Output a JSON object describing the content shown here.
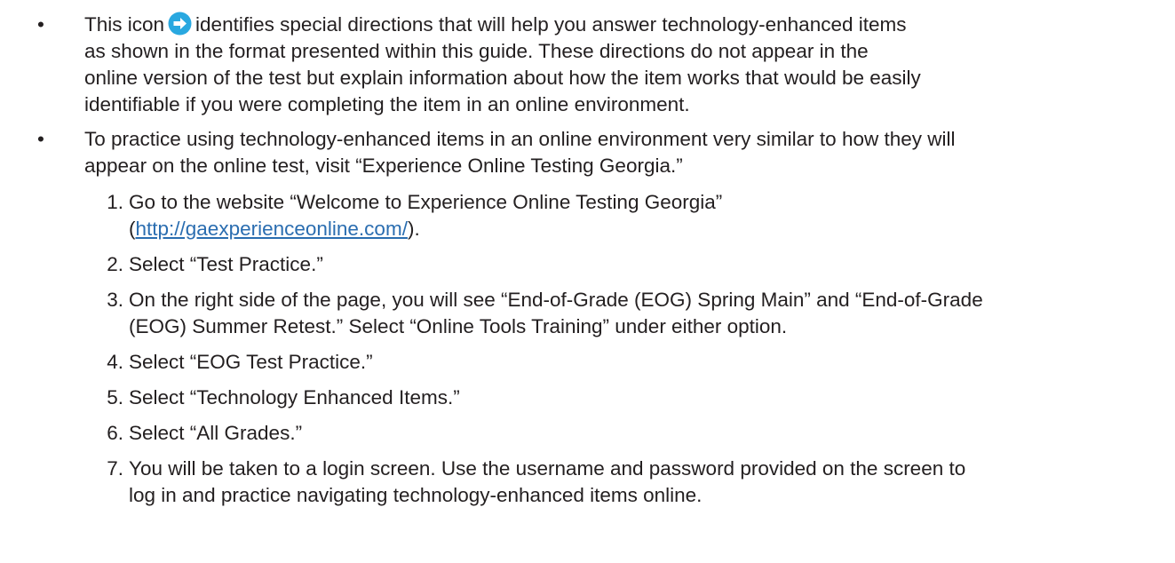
{
  "bullets": [
    {
      "marker": "•",
      "lines": [
        {
          "before": "This icon",
          "icon": "arrow-right-circle-icon",
          "after": "identifies special directions that will help you answer technology-enhanced items"
        },
        {
          "text": "as shown in the format presented within this guide. These directions do not appear in the"
        },
        {
          "text": "online version of the test but explain information about how the item works that would be easily"
        },
        {
          "text": "identifiable if you were completing the item in an online environment."
        }
      ]
    },
    {
      "marker": "•",
      "lines": [
        {
          "text": "To practice using technology-enhanced items in an online environment very similar to how they will"
        },
        {
          "text": "appear on the online test, visit “Experience Online Testing Georgia.”"
        }
      ]
    }
  ],
  "steps": [
    {
      "number": "1.",
      "line1": "Go to the website “Welcome to Experience Online Testing Georgia”",
      "line2_open": "(",
      "link": "http://gaexperienceonline.com/",
      "line2_close": ")."
    },
    {
      "number": "2.",
      "lines": [
        "Select “Test Practice.”"
      ]
    },
    {
      "number": "3.",
      "lines": [
        "On the right side of the page, you will see “End-of-Grade (EOG) Spring Main” and “End-of-Grade",
        "(EOG) Summer Retest.” Select “Online Tools Training” under either option."
      ]
    },
    {
      "number": "4.",
      "lines": [
        "Select “EOG Test Practice.”"
      ]
    },
    {
      "number": "5.",
      "lines": [
        "Select “Technology Enhanced Items.”"
      ]
    },
    {
      "number": "6.",
      "lines": [
        "Select “All Grades.”"
      ]
    },
    {
      "number": "7.",
      "lines": [
        "You will be taken to a login screen. Use the username and password provided on the screen to",
        "log in and practice navigating technology-enhanced items online."
      ]
    }
  ],
  "colors": {
    "icon": "#29a8e0",
    "link": "#2a6db0",
    "text": "#231f20"
  }
}
